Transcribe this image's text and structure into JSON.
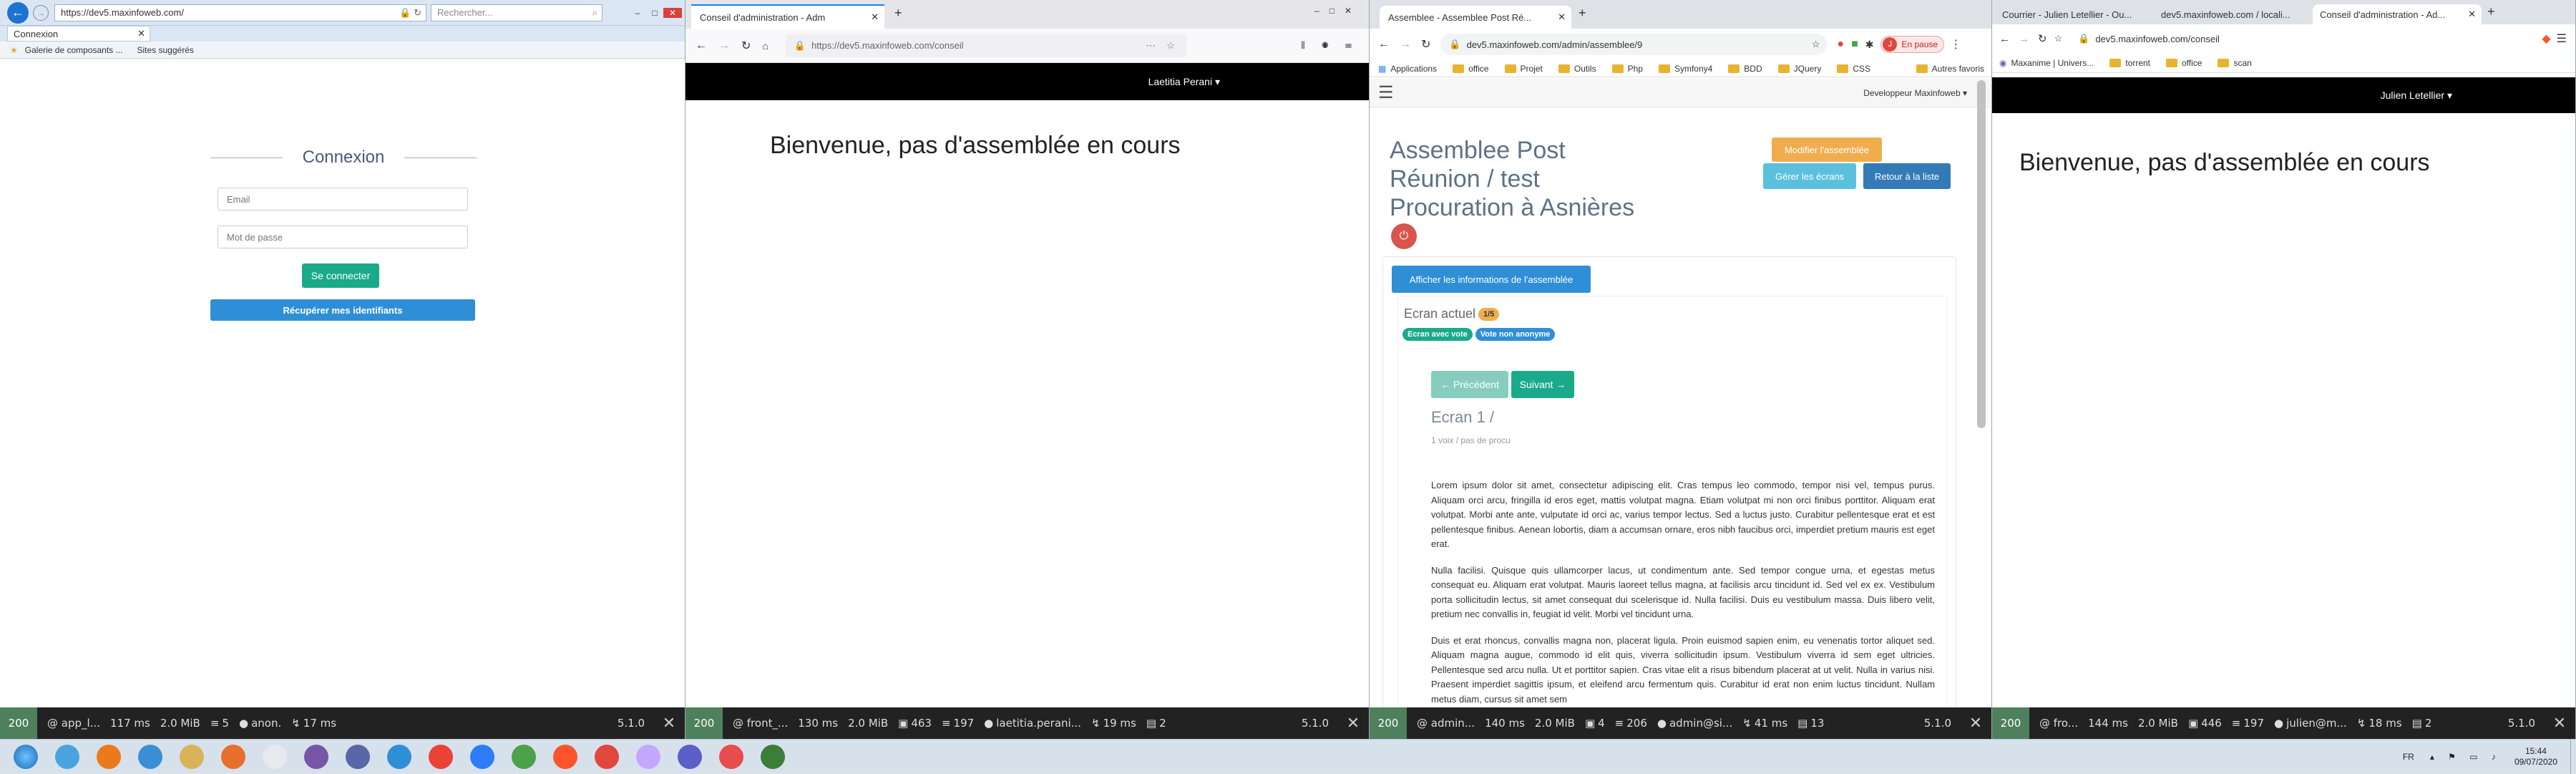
{
  "win1": {
    "tab_url": "https://dev5.maxinfoweb.com/",
    "search_placeholder": "Rechercher...",
    "tab_title": "Connexion",
    "bookmarks": [
      "Galerie de composants ...",
      "Sites suggérés"
    ],
    "heading": "Connexion",
    "email_placeholder": "Email",
    "password_placeholder": "Mot de passe",
    "login_button": "Se connecter",
    "recover_button": "Récupérer mes identifiants",
    "profiler": {
      "status": "200",
      "route": "@ app_l...",
      "time": "117 ms",
      "mem": "2.0 MiB",
      "db": "5",
      "user": "anon.",
      "ajax": "17 ms",
      "version": "5.1.0"
    }
  },
  "win2": {
    "tab_title": "Conseil d'administration - Adm",
    "url": "https://dev5.maxinfoweb.com/conseil",
    "user_menu": "Laetitia Perani ▾",
    "heading": "Bienvenue, pas d'assemblée en cours",
    "profiler": {
      "status": "200",
      "route": "@ front_...",
      "time": "130 ms",
      "mem": "2.0 MiB",
      "forms": "463",
      "db": "197",
      "user": "laetitia.perani...",
      "ajax": "19 ms",
      "cache": "2",
      "version": "5.1.0"
    }
  },
  "win3": {
    "tab_title": "Assemblee - Assemblee Post Ré...",
    "url": "dev5.maxinfoweb.com/admin/assemblee/9",
    "pause_label": "En pause",
    "bookmarks": [
      "Applications",
      "office",
      "Projet",
      "Outils",
      "Php",
      "Symfony4",
      "BDD",
      "JQuery",
      "CSS",
      "Autres favoris"
    ],
    "user_menu": "Developpeur Maxinfoweb ▾",
    "title_lines": [
      "Assemblee Post",
      "Réunion / test",
      "Procuration à Asnières"
    ],
    "btn_modify": "Modifier l'assemblée",
    "btn_screens": "Gérer les écrans",
    "btn_back": "Retour à la liste",
    "btn_info": "Afficher les informations de l'assemblée",
    "current_label": "Ecran actuel",
    "current_count": "1/5",
    "badge_vote": "Ecran avec vote",
    "badge_nonanon": "Vote non anonyme",
    "btn_prev": "← Précédent",
    "btn_next": "Suivant →",
    "screen_title": "Ecran 1 /",
    "screen_sub": "1 voix / pas de procu",
    "paragraphs": [
      "Lorem ipsum dolor sit amet, consectetur adipiscing elit. Cras tempus leo commodo, tempor nisi vel, tempus purus. Aliquam orci arcu, fringilla id eros eget, mattis volutpat magna. Etiam volutpat mi non orci finibus porttitor. Aliquam erat volutpat. Morbi ante ante, vulputate id orci ac, varius tempor lectus. Sed a luctus justo. Curabitur pellentesque erat et est pellentesque finibus. Aenean lobortis, diam a accumsan ornare, eros nibh faucibus orci, imperdiet pretium mauris est eget erat.",
      "Nulla facilisi. Quisque quis ullamcorper lacus, ut condimentum ante. Sed tempor congue urna, et egestas metus consequat eu. Aliquam erat volutpat. Mauris laoreet tellus magna, at facilisis arcu tincidunt id. Sed vel ex ex. Vestibulum porta sollicitudin lectus, sit amet consequat dui scelerisque id. Nulla facilisi. Duis eu vestibulum massa. Duis libero velit, pretium nec convallis in, feugiat id velit. Morbi vel tincidunt urna.",
      "Duis et erat rhoncus, convallis magna non, placerat ligula. Proin euismod sapien enim, eu venenatis tortor aliquet sed. Aliquam magna augue, commodo id elit quis, viverra sollicitudin ipsum. Vestibulum viverra id sem eget ultricies. Pellentesque sed arcu nulla. Ut et porttitor sapien. Cras vitae elit a risus bibendum placerat at ut velit. Nulla in varius nisi. Praesent imperdiet sagittis ipsum, et eleifend arcu fermentum quis. Curabitur id erat non enim luctus tincidunt. Nullam metus diam, cursus sit amet sem"
    ],
    "profiler": {
      "status": "200",
      "route": "@ admin...",
      "time": "140 ms",
      "mem": "2.0 MiB",
      "forms": "4",
      "db": "206",
      "user": "admin@si...",
      "ajax": "41 ms",
      "cache": "13",
      "version": "5.1.0"
    }
  },
  "win4": {
    "tabs": [
      "Courrier - Julien Letellier - Ou...",
      "dev5.maxinfoweb.com / locali...",
      "Conseil d'administration - Ad..."
    ],
    "url": "dev5.maxinfoweb.com/conseil",
    "bookmarks": [
      "Maxanime | Univers...",
      "torrent",
      "office",
      "scan"
    ],
    "user_menu": "Julien Letellier ▾",
    "heading": "Bienvenue, pas d'assemblée en cours",
    "profiler": {
      "status": "200",
      "route": "@ fro...",
      "time": "144 ms",
      "mem": "2.0 MiB",
      "forms": "446",
      "db": "197",
      "user": "julien@m...",
      "ajax": "18 ms",
      "cache": "2",
      "version": "5.1.0"
    }
  },
  "taskbar": {
    "lang": "FR",
    "time": "15:44",
    "date": "09/07/2020",
    "app_colors": [
      "#4aa3df",
      "#ea7a1c",
      "#3a8fd4",
      "#d9b35a",
      "#e66f2b",
      "#e8e8ef",
      "#7756a8",
      "#5867a8",
      "#2f8fd6",
      "#ea4335",
      "#2d7df6",
      "#4da14a",
      "#fb542b",
      "#e0473d",
      "#c4a6ff",
      "#5b5fc7",
      "#e84c4c",
      "#3c7d38"
    ]
  }
}
